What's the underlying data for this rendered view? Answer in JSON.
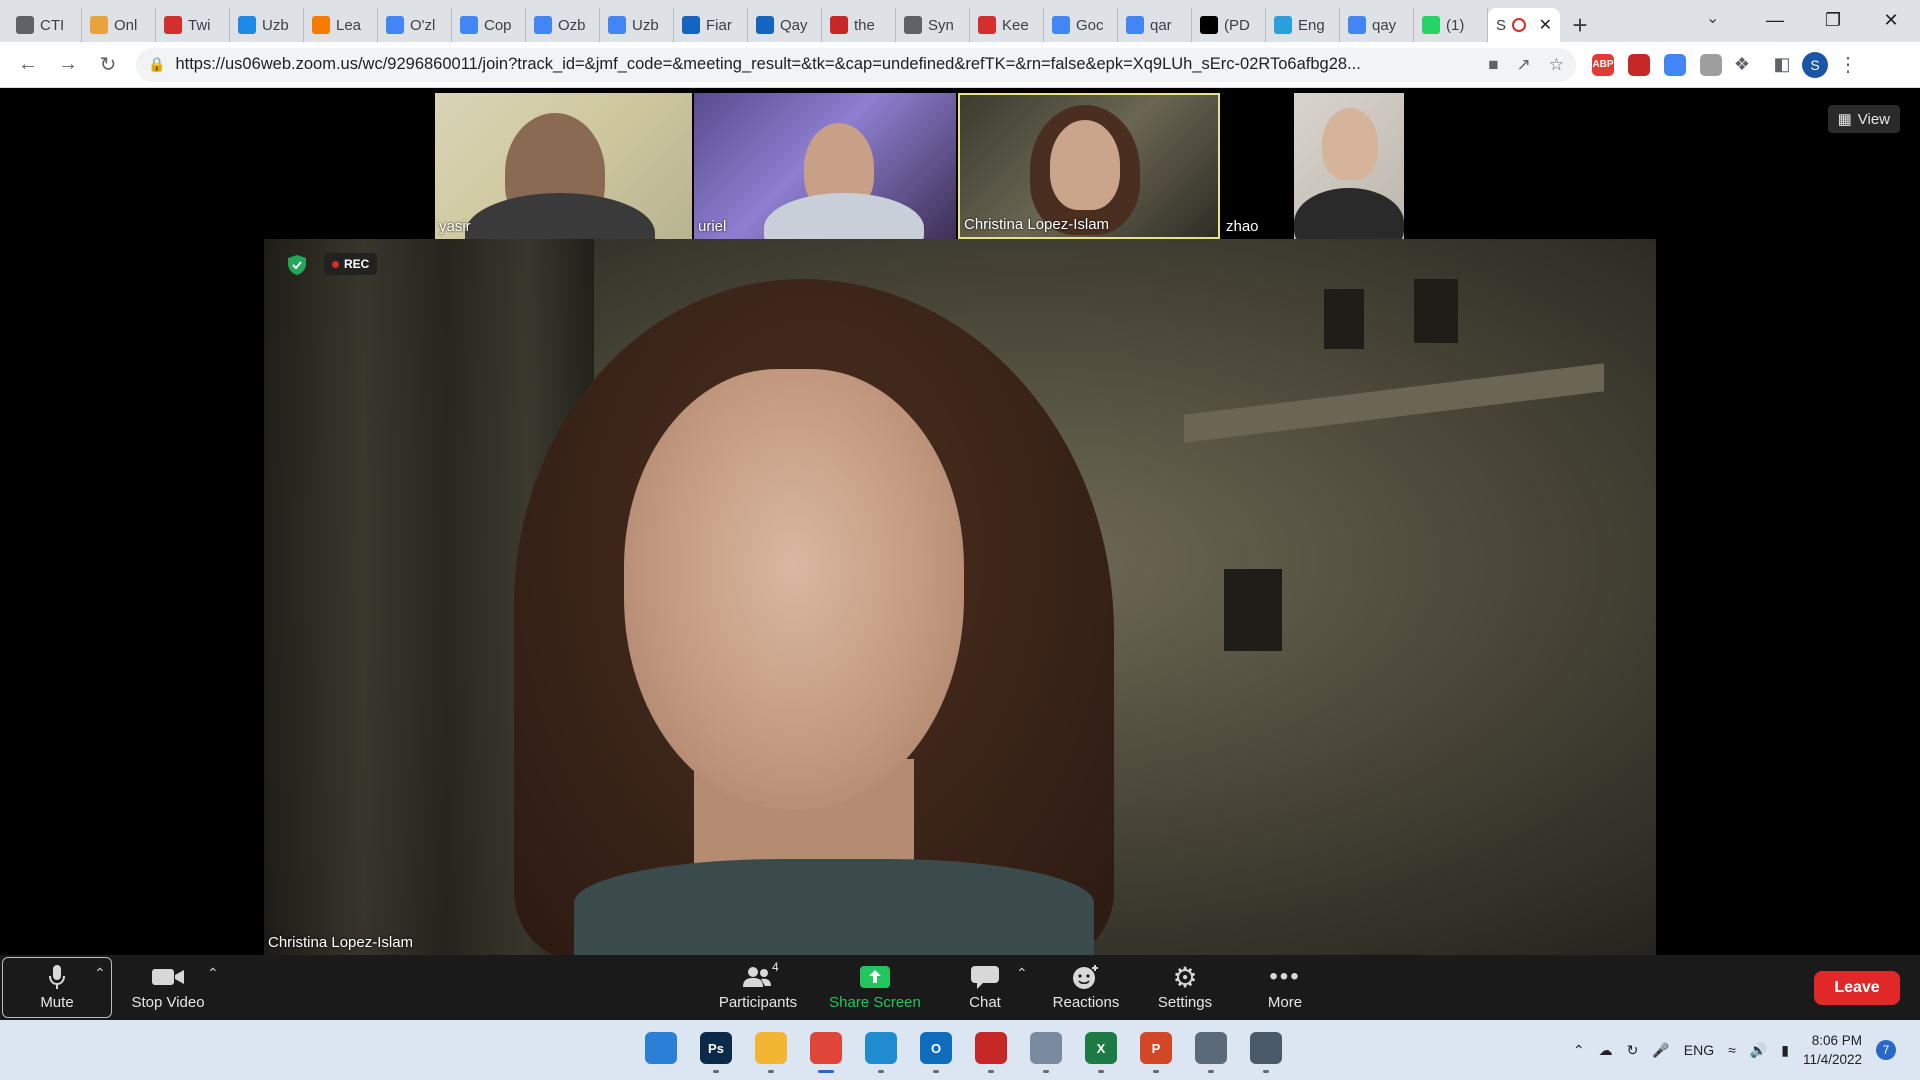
{
  "browser": {
    "tabs": [
      {
        "title": "CTI",
        "icon": "globe-icon",
        "color": "#5f6368"
      },
      {
        "title": "Onl",
        "icon": "grid-globe-icon",
        "color": "#e8a33d"
      },
      {
        "title": "Twi",
        "icon": "flag-icon",
        "color": "#d32f2f"
      },
      {
        "title": "Uzb",
        "icon": "uzbek-flag-icon",
        "color": "#1e88e5"
      },
      {
        "title": "Lea",
        "icon": "blogger-icon",
        "color": "#f57c00"
      },
      {
        "title": "O'zl",
        "icon": "docs-icon",
        "color": "#4285f4"
      },
      {
        "title": "Cop",
        "icon": "docs-icon",
        "color": "#4285f4"
      },
      {
        "title": "Ozb",
        "icon": "docs-icon",
        "color": "#4285f4"
      },
      {
        "title": "Uzb",
        "icon": "docs-icon",
        "color": "#4285f4"
      },
      {
        "title": "Fiar",
        "icon": "edge-globe-icon",
        "color": "#1565c0"
      },
      {
        "title": "Qay",
        "icon": "edge-globe-icon",
        "color": "#1565c0"
      },
      {
        "title": "the",
        "icon": "pdf-icon",
        "color": "#c62828"
      },
      {
        "title": "Syn",
        "icon": "globe-icon",
        "color": "#5f6368"
      },
      {
        "title": "Kee",
        "icon": "keep-icon",
        "color": "#d32f2f"
      },
      {
        "title": "Goc",
        "icon": "translate-icon",
        "color": "#4285f4"
      },
      {
        "title": "qar",
        "icon": "google-icon",
        "color": "#4285f4"
      },
      {
        "title": "(PD",
        "icon": "font-a-icon",
        "color": "#000000"
      },
      {
        "title": "Eng",
        "icon": "telegram-icon",
        "color": "#29a0da"
      },
      {
        "title": "qay",
        "icon": "google-icon",
        "color": "#4285f4"
      },
      {
        "title": "(1)",
        "icon": "whatsapp-icon",
        "color": "#25d366"
      }
    ],
    "active_tab": {
      "title": "S",
      "icon": "recording-icon",
      "color": "#e02828"
    },
    "url": "https://us06web.zoom.us/wc/9296860011/join?track_id=&jmf_code=&meeting_result=&tk=&cap=undefined&refTK=&rn=false&epk=Xq9LUh_sErc-02RTo6afbg28...",
    "extensions": [
      {
        "name": "adblock-icon",
        "label": "ABP",
        "color": "#e53935"
      },
      {
        "name": "shield-ext-icon",
        "label": "",
        "color": "#c62828"
      },
      {
        "name": "translate-ext-icon",
        "label": "",
        "color": "#4285f4"
      },
      {
        "name": "user-ext-icon",
        "label": "",
        "color": "#9e9e9e"
      }
    ],
    "profile_initial": "S"
  },
  "meeting": {
    "view_label": "View",
    "rec_label": "REC",
    "participants": [
      {
        "name": "yasir"
      },
      {
        "name": "uriel"
      },
      {
        "name": "Christina Lopez-Islam"
      },
      {
        "name": "zhao"
      }
    ],
    "active_speaker": "Christina Lopez-Islam"
  },
  "controls": {
    "mute": "Mute",
    "stop_video": "Stop Video",
    "participants": "Participants",
    "participants_count": "4",
    "share_screen": "Share Screen",
    "chat": "Chat",
    "reactions": "Reactions",
    "settings": "Settings",
    "more": "More",
    "leave": "Leave"
  },
  "taskbar": {
    "apps": [
      {
        "name": "windows-start-icon",
        "label": "",
        "color": "#2b7fd6"
      },
      {
        "name": "photoshop-icon",
        "label": "Ps",
        "color": "#0b2a4a"
      },
      {
        "name": "file-explorer-icon",
        "label": "",
        "color": "#f2b632"
      },
      {
        "name": "chrome-icon",
        "label": "",
        "color": "#e0453a"
      },
      {
        "name": "edge-icon",
        "label": "",
        "color": "#1f8ccf"
      },
      {
        "name": "outlook-icon",
        "label": "O",
        "color": "#0f6cbd"
      },
      {
        "name": "acrobat-icon",
        "label": "",
        "color": "#c62828"
      },
      {
        "name": "app-icon",
        "label": "",
        "color": "#7a8aa0"
      },
      {
        "name": "excel-icon",
        "label": "X",
        "color": "#1d7a45"
      },
      {
        "name": "powerpoint-icon",
        "label": "P",
        "color": "#d24726"
      },
      {
        "name": "settings-app-icon",
        "label": "",
        "color": "#5a6a7a"
      },
      {
        "name": "calculator-icon",
        "label": "",
        "color": "#4a5a6a"
      }
    ],
    "language": "ENG",
    "time": "8:06 PM",
    "date": "11/4/2022",
    "notifications": "7"
  }
}
